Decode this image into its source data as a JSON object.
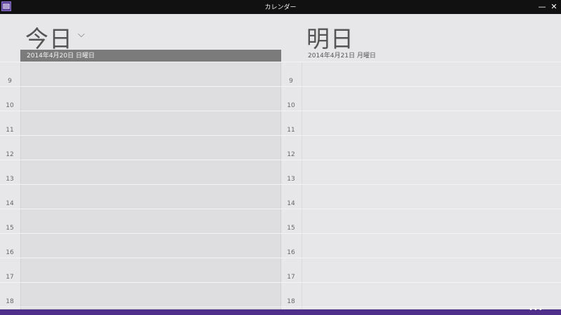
{
  "window": {
    "title": "カレンダー",
    "minimize_glyph": "—",
    "close_glyph": "✕",
    "icon": "calendar-app-icon"
  },
  "days": [
    {
      "heading": "今日",
      "date": "2014年4月20日 日曜日",
      "has_dropdown": true
    },
    {
      "heading": "明日",
      "date": "2014年4月21日 月曜日",
      "has_dropdown": false
    }
  ],
  "dropdown_glyph": "⌵",
  "hours": [
    "9",
    "10",
    "11",
    "12",
    "13",
    "14",
    "15",
    "16",
    "17",
    "18"
  ],
  "appbar": {
    "more_glyph": "•••",
    "color": "#4e2f8a"
  },
  "colors": {
    "today_date_bar": "#7b7b7b",
    "background": "#e7e7e9"
  }
}
